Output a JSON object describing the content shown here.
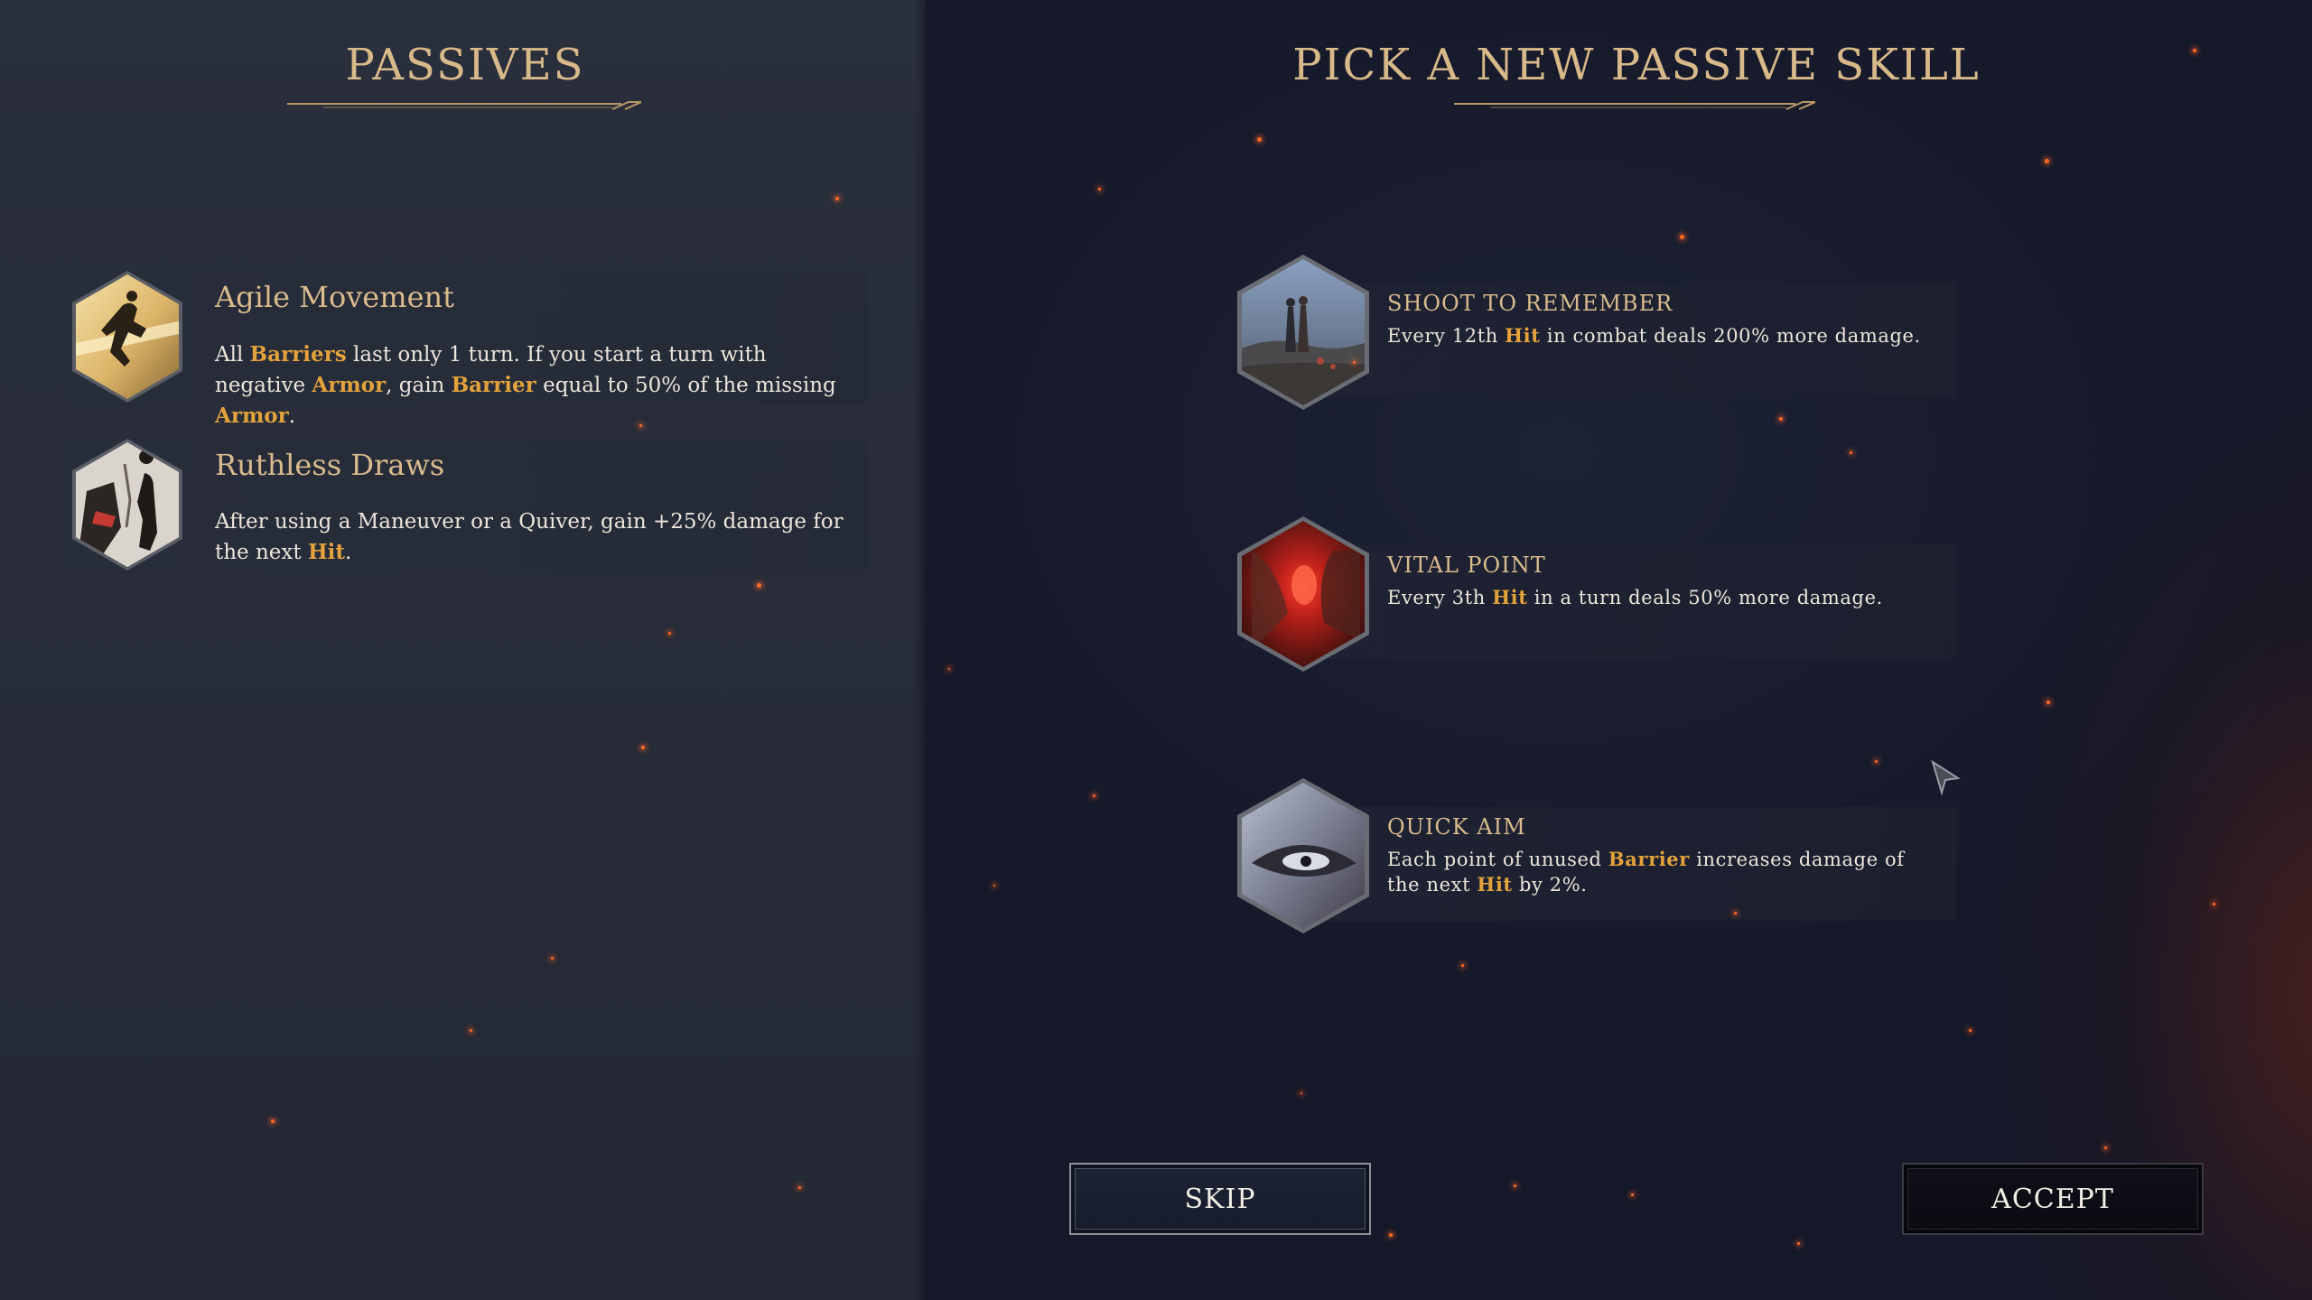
{
  "left_panel": {
    "heading": "PASSIVES",
    "passives": [
      {
        "name": "Agile Movement",
        "icon": "leaping-figure-icon",
        "desc_parts": [
          {
            "t": "All "
          },
          {
            "t": "Barriers",
            "kw": true
          },
          {
            "t": " last only 1 turn. If you start a turn with negative "
          },
          {
            "t": "Armor",
            "kw": true
          },
          {
            "t": ", gain "
          },
          {
            "t": "Barrier",
            "kw": true
          },
          {
            "t": " equal to 50% of the missing "
          },
          {
            "t": "Armor",
            "kw": true
          },
          {
            "t": "."
          }
        ]
      },
      {
        "name": "Ruthless Draws",
        "icon": "gunslinger-draw-icon",
        "desc_parts": [
          {
            "t": "After using a Maneuver or a Quiver, gain +25% damage for the next "
          },
          {
            "t": "Hit",
            "kw": true
          },
          {
            "t": "."
          }
        ]
      }
    ]
  },
  "right_panel": {
    "heading": "PICK A NEW PASSIVE SKILL",
    "skills": [
      {
        "name": "SHOOT TO REMEMBER",
        "icon": "figures-on-cliff-icon",
        "desc_parts": [
          {
            "t": "Every 12th "
          },
          {
            "t": "Hit",
            "kw": true
          },
          {
            "t": " in combat deals 200% more damage."
          }
        ]
      },
      {
        "name": "VITAL POINT",
        "icon": "glowing-wound-icon",
        "desc_parts": [
          {
            "t": "Every 3th "
          },
          {
            "t": "Hit",
            "kw": true
          },
          {
            "t": " in a turn deals 50% more damage."
          }
        ]
      },
      {
        "name": "QUICK AIM",
        "icon": "eye-closeup-icon",
        "desc_parts": [
          {
            "t": "Each point of unused "
          },
          {
            "t": "Barrier",
            "kw": true
          },
          {
            "t": " increases damage of the next "
          },
          {
            "t": "Hit",
            "kw": true
          },
          {
            "t": " by 2%."
          }
        ]
      }
    ],
    "buttons": {
      "skip": "SKIP",
      "accept": "ACCEPT"
    }
  },
  "colors": {
    "heading": "#d8b98a",
    "keyword": "#e2a23c",
    "body_text": "#ece6da",
    "left_bg": "#272c38",
    "right_bg": "#171b2c",
    "ember": "#ff6a2a"
  }
}
